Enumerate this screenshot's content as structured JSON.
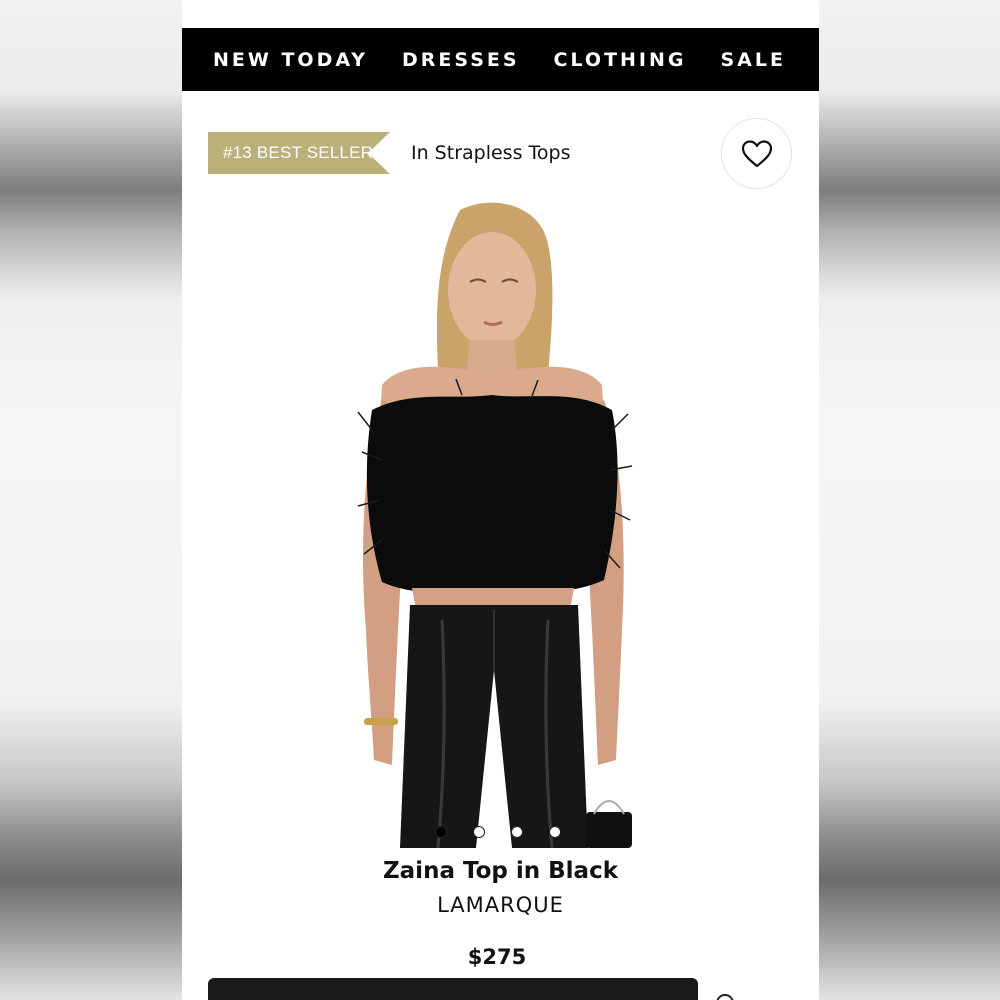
{
  "nav": {
    "items": [
      {
        "label": "NEW TODAY"
      },
      {
        "label": "DRESSES"
      },
      {
        "label": "CLOTHING"
      },
      {
        "label": "SALE"
      }
    ]
  },
  "badge": {
    "rank_label": "#13 BEST SELLER",
    "category": "In Strapless Tops",
    "color": "#b9b07a"
  },
  "wishlist": {
    "icon": "heart-icon"
  },
  "gallery": {
    "image_count": 4,
    "active_index": 0
  },
  "product": {
    "name": "Zaina Top in Black",
    "brand": "LAMARQUE",
    "price": "$275"
  },
  "colors": {
    "nav_background": "#000000",
    "nav_text": "#ffffff",
    "page_background": "#ffffff"
  }
}
